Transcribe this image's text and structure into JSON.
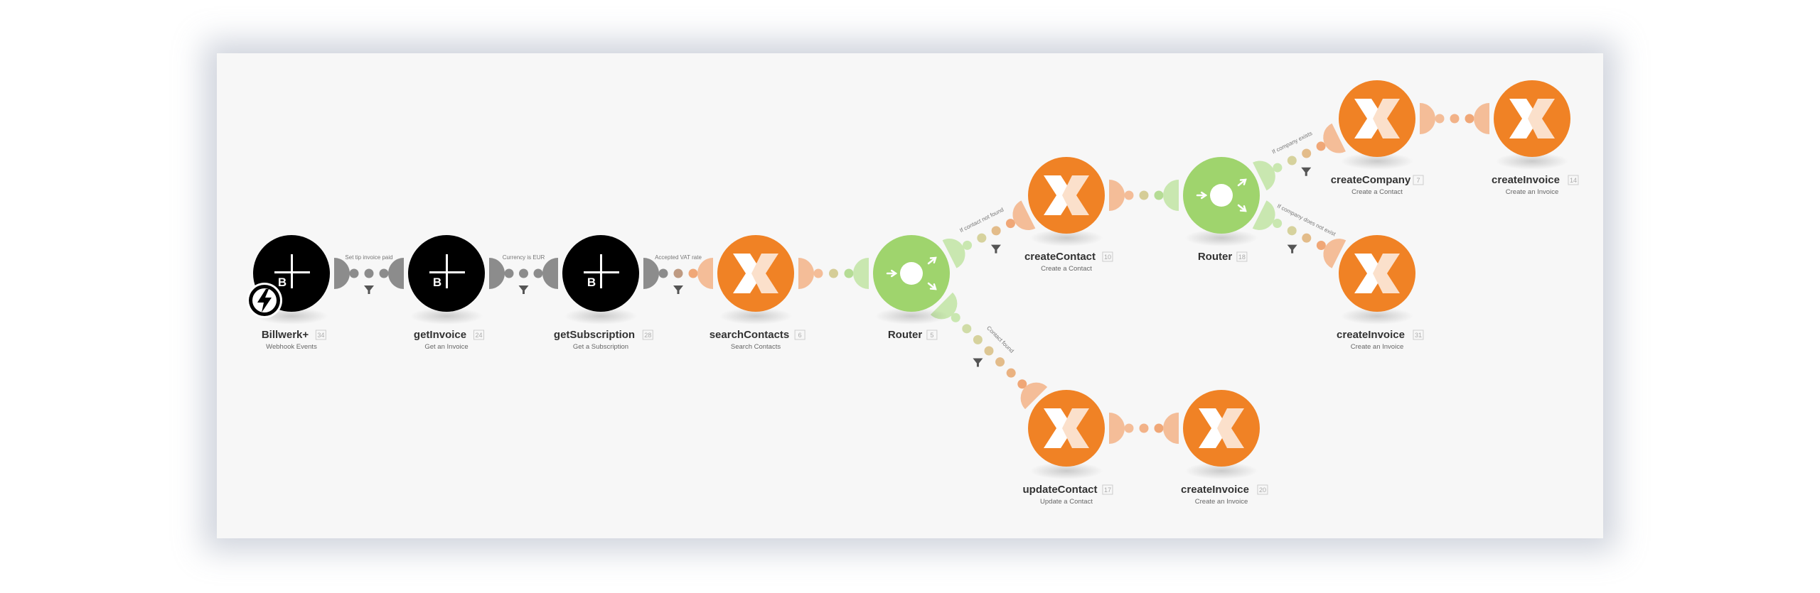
{
  "scenario": {
    "colors": {
      "canvas_bg": "#f7f7f7",
      "billwerk": "#000000",
      "billwerk_handle": "#8c8c8c",
      "sevdesk": "#f08225",
      "sevdesk_handle": "#f4bd98",
      "router": "#9fd46d",
      "router_handle": "#c9e7b0",
      "filter_icon": "#555555"
    },
    "nodes": [
      {
        "id": "billwerk-trigger",
        "app": "billwerk",
        "title": "Billwerk+",
        "number": "34",
        "subtitle": "Webhook Events",
        "trigger": true
      },
      {
        "id": "get-invoice",
        "app": "billwerk",
        "title": "getInvoice",
        "number": "24",
        "subtitle": "Get an Invoice"
      },
      {
        "id": "get-subscription",
        "app": "billwerk",
        "title": "getSubscription",
        "number": "28",
        "subtitle": "Get a Subscription"
      },
      {
        "id": "search-contacts",
        "app": "sevdesk",
        "title": "searchContacts",
        "number": "6",
        "subtitle": "Search Contacts"
      },
      {
        "id": "router-main",
        "app": "router",
        "title": "Router",
        "number": "5",
        "subtitle": ""
      },
      {
        "id": "create-contact",
        "app": "sevdesk",
        "title": "createContact",
        "number": "10",
        "subtitle": "Create a Contact"
      },
      {
        "id": "router-company",
        "app": "router",
        "title": "Router",
        "number": "18",
        "subtitle": ""
      },
      {
        "id": "create-company",
        "app": "sevdesk",
        "title": "createCompany",
        "number": "7",
        "subtitle": "Create a Contact"
      },
      {
        "id": "create-invoice-14",
        "app": "sevdesk",
        "title": "createInvoice",
        "number": "14",
        "subtitle": "Create an Invoice"
      },
      {
        "id": "create-invoice-31",
        "app": "sevdesk",
        "title": "createInvoice",
        "number": "31",
        "subtitle": "Create an Invoice"
      },
      {
        "id": "update-contact",
        "app": "sevdesk",
        "title": "updateContact",
        "number": "17",
        "subtitle": "Update a Contact"
      },
      {
        "id": "create-invoice-20",
        "app": "sevdesk",
        "title": "createInvoice",
        "number": "20",
        "subtitle": "Create an Invoice"
      }
    ],
    "links": [
      {
        "from": "billwerk-trigger",
        "to": "get-invoice",
        "filter": "Set tip invoice paid",
        "has_filter": true
      },
      {
        "from": "get-invoice",
        "to": "get-subscription",
        "filter": "Currency is EUR",
        "has_filter": true
      },
      {
        "from": "get-subscription",
        "to": "search-contacts",
        "filter": "Accepted VAT rate",
        "has_filter": true
      },
      {
        "from": "search-contacts",
        "to": "router-main",
        "filter": "",
        "has_filter": false
      },
      {
        "from": "router-main",
        "to": "create-contact",
        "filter": "If contact not found",
        "has_filter": true
      },
      {
        "from": "router-main",
        "to": "update-contact",
        "filter": "Contact found",
        "has_filter": true
      },
      {
        "from": "create-contact",
        "to": "router-company",
        "filter": "",
        "has_filter": false
      },
      {
        "from": "router-company",
        "to": "create-company",
        "filter": "If company exists",
        "has_filter": true
      },
      {
        "from": "router-company",
        "to": "create-invoice-31",
        "filter": "If company does not exist",
        "has_filter": true
      },
      {
        "from": "create-company",
        "to": "create-invoice-14",
        "filter": "",
        "has_filter": false
      },
      {
        "from": "update-contact",
        "to": "create-invoice-20",
        "filter": "",
        "has_filter": false
      }
    ]
  }
}
